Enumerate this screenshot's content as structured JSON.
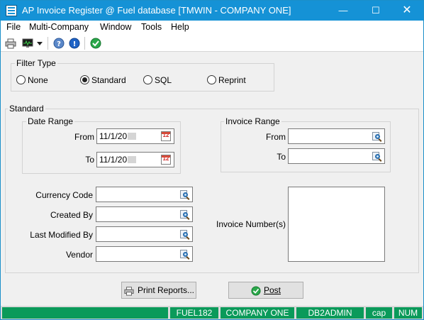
{
  "window": {
    "title": "AP Invoice Register @ Fuel database [TMWIN - COMPANY ONE]",
    "controls": {
      "minimize": "—",
      "maximize": "☐",
      "close": "✕"
    }
  },
  "menu": [
    "File",
    "Multi-Company",
    "Window",
    "Tools",
    "Help"
  ],
  "toolbar": {
    "icons": [
      "printer-icon",
      "monitor-icon",
      "dropdown-arrow-icon",
      "help-icon",
      "info-icon",
      "checkmark-icon"
    ]
  },
  "filter_type": {
    "label": "Filter Type",
    "options": [
      "None",
      "Standard",
      "SQL",
      "Reprint"
    ],
    "selected": "Standard"
  },
  "standard": {
    "label": "Standard",
    "date_range": {
      "label": "Date Range",
      "from_label": "From",
      "from_value": "11/1/20",
      "to_label": "To",
      "to_value": "11/1/20"
    },
    "invoice_range": {
      "label": "Invoice Range",
      "from_label": "From",
      "from_value": "",
      "to_label": "To",
      "to_value": ""
    },
    "currency_code": {
      "label": "Currency Code",
      "value": ""
    },
    "created_by": {
      "label": "Created By",
      "value": ""
    },
    "last_modified_by": {
      "label": "Last Modified By",
      "value": ""
    },
    "vendor": {
      "label": "Vendor",
      "value": ""
    },
    "invoice_numbers": {
      "label": "Invoice Number(s)"
    }
  },
  "buttons": {
    "print_reports": "Print Reports...",
    "post": "Post"
  },
  "statusbar": [
    "FUEL182",
    "COMPANY ONE",
    "DB2ADMIN",
    "cap",
    "NUM"
  ],
  "colors": {
    "titlebar": "#1592d6",
    "statusbar_segment": "#0a9a5a",
    "window_bg": "#f0f0f0"
  }
}
